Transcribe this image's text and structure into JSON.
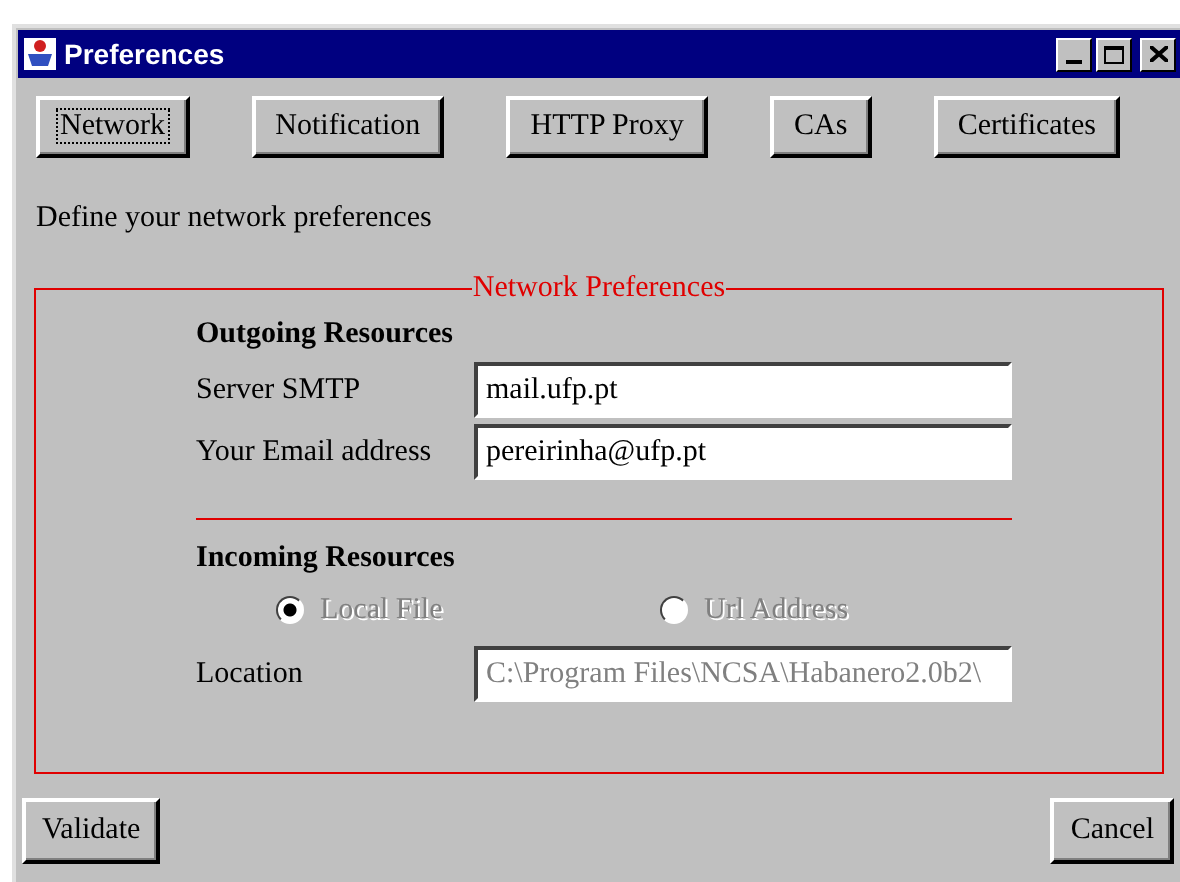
{
  "window": {
    "title": "Preferences"
  },
  "tabs": [
    {
      "label": "Network",
      "focused": true
    },
    {
      "label": "Notification",
      "focused": false
    },
    {
      "label": "HTTP Proxy",
      "focused": false
    },
    {
      "label": "CAs",
      "focused": false
    },
    {
      "label": "Certificates",
      "focused": false
    }
  ],
  "description": "Define your network preferences",
  "group": {
    "title": "Network Preferences",
    "outgoing": {
      "heading": "Outgoing Resources",
      "fields": [
        {
          "label": "Server SMTP",
          "value": "mail.ufp.pt"
        },
        {
          "label": "Your Email address",
          "value": "pereirinha@ufp.pt"
        }
      ]
    },
    "incoming": {
      "heading": "Incoming Resources",
      "options": [
        {
          "label": "Local File",
          "selected": true,
          "disabled": true
        },
        {
          "label": "Url Address",
          "selected": false,
          "disabled": true
        }
      ],
      "location": {
        "label": "Location",
        "value": "C:\\Program Files\\NCSA\\Habanero2.0b2\\",
        "disabled": true
      }
    }
  },
  "buttons": [
    "Validate",
    "Cancel"
  ]
}
